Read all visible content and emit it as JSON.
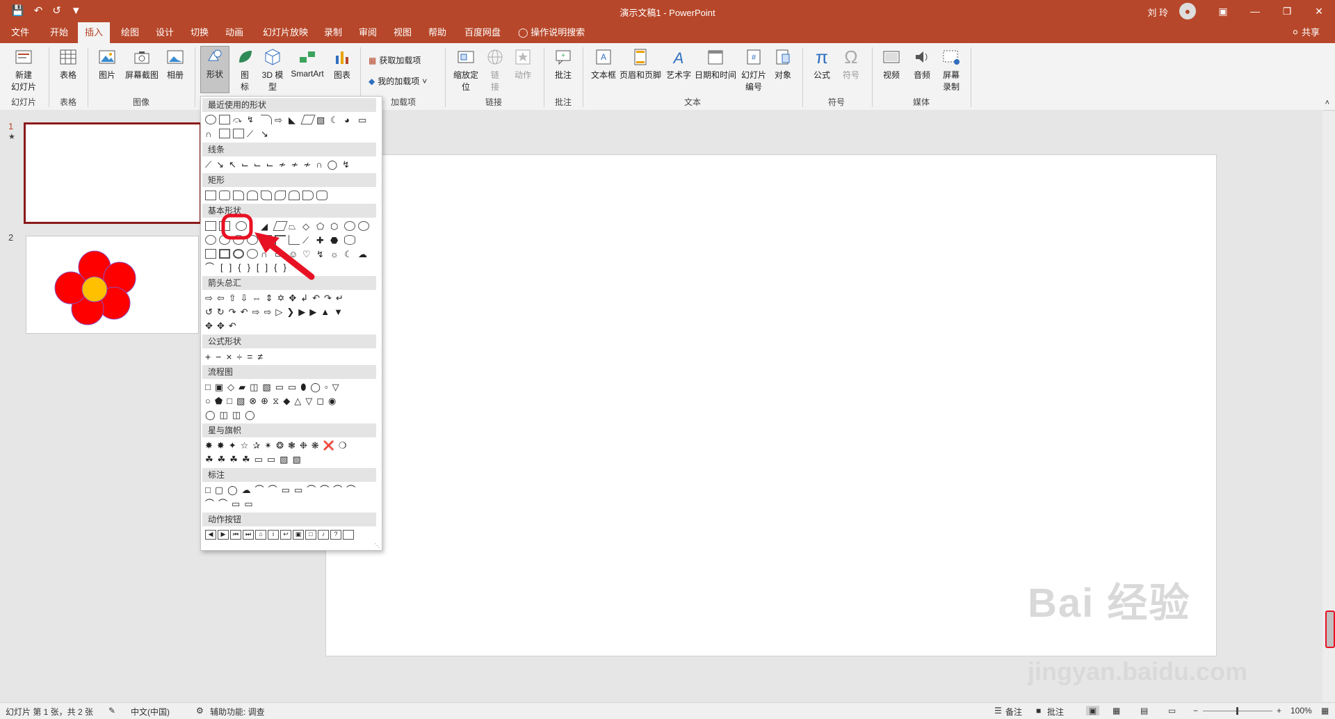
{
  "window": {
    "title": "演示文稿1  -  PowerPoint",
    "user": "刘 玲"
  },
  "colors": {
    "accent": "#b7472a",
    "highlight": "#e81123",
    "petal": "#ff0000",
    "center": "#ffc000"
  },
  "quick_access": [
    "save-icon",
    "undo-icon",
    "redo-icon",
    "customize-icon"
  ],
  "tabs": [
    "文件",
    "开始",
    "插入",
    "绘图",
    "设计",
    "切换",
    "动画",
    "幻灯片放映",
    "录制",
    "审阅",
    "视图",
    "帮助",
    "百度网盘"
  ],
  "tellme": "操作说明搜索",
  "share": "共享",
  "ribbon": {
    "new_slide": "新建\n幻灯片",
    "table": "表格",
    "picture": "图片",
    "screenshot": "屏幕截图",
    "album": "相册",
    "shapes": "形状",
    "icons": "图\n标",
    "model3d": "3D 模\n型",
    "smartart": "SmartArt",
    "chart": "图表",
    "get_addins": "获取加载项",
    "my_addins": "我的加载项",
    "zoom": "缩放定\n位",
    "link": "链\n接",
    "action": "动作",
    "comment": "批注",
    "textbox": "文本框",
    "header_footer": "页眉和页脚",
    "wordart": "艺术字",
    "datetime": "日期和时间",
    "slide_number": "幻灯片\n编号",
    "object": "对象",
    "equation": "公式",
    "symbol": "符号",
    "video": "视频",
    "audio": "音频",
    "screen_record": "屏幕\n录制",
    "groups": {
      "slides": "幻灯片",
      "tables": "表格",
      "images": "图像",
      "addins": "加载项",
      "links": "链接",
      "comments": "批注",
      "text": "文本",
      "symbols": "符号",
      "media": "媒体"
    }
  },
  "shapes_menu": {
    "sections": [
      "最近使用的形状",
      "线条",
      "矩形",
      "基本形状",
      "箭头总汇",
      "公式形状",
      "流程图",
      "星与旗帜",
      "标注",
      "动作按钮"
    ]
  },
  "slides": [
    {
      "num": "1"
    },
    {
      "num": "2"
    }
  ],
  "slide1_marker": "★",
  "status": {
    "slide_info": "幻灯片 第 1 张，共 2 张",
    "language": "中文(中国)",
    "accessibility": "辅助功能: 调查",
    "notes": "备注",
    "comments": "批注",
    "zoom": "100%"
  },
  "watermark": {
    "text": "Bai 经验",
    "domain": "jingyan.baidu.com"
  }
}
